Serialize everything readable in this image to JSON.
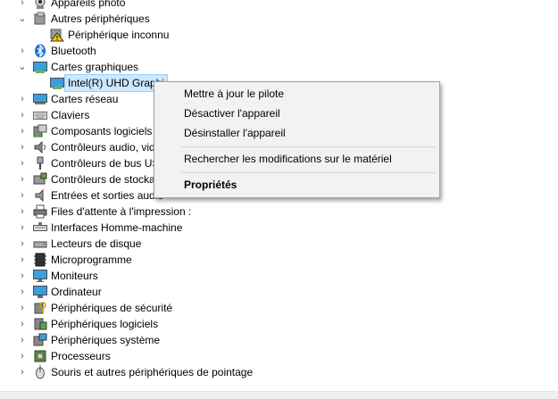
{
  "tree": {
    "items": [
      {
        "label": "Appareils photo",
        "icon": "camera-icon",
        "chevron": "›"
      },
      {
        "label": "Autres périphériques",
        "icon": "unknown-device-icon",
        "chevron": "⌄"
      },
      {
        "label": "Périphérique inconnu",
        "icon": "warning-device-icon",
        "chevron": ""
      },
      {
        "label": "Bluetooth",
        "icon": "bluetooth-icon",
        "chevron": "›"
      },
      {
        "label": "Cartes graphiques",
        "icon": "display-adapter-icon",
        "chevron": "⌄"
      },
      {
        "label": "Intel(R) UHD Graphi",
        "icon": "display-adapter-icon",
        "chevron": ""
      },
      {
        "label": "Cartes réseau",
        "icon": "network-icon",
        "chevron": "›"
      },
      {
        "label": "Claviers",
        "icon": "keyboard-icon",
        "chevron": "›"
      },
      {
        "label": "Composants logiciels",
        "icon": "software-component-icon",
        "chevron": "›"
      },
      {
        "label": "Contrôleurs audio, vid",
        "icon": "audio-icon",
        "chevron": "›"
      },
      {
        "label": "Contrôleurs de bus US",
        "icon": "usb-icon",
        "chevron": "›"
      },
      {
        "label": "Contrôleurs de stocka",
        "icon": "storage-icon",
        "chevron": "›"
      },
      {
        "label": "Entrées et sorties audio",
        "icon": "speaker-icon",
        "chevron": "›"
      },
      {
        "label": "Files d'attente à l'impression :",
        "icon": "printer-icon",
        "chevron": "›"
      },
      {
        "label": "Interfaces Homme-machine",
        "icon": "hid-icon",
        "chevron": "›"
      },
      {
        "label": "Lecteurs de disque",
        "icon": "disk-icon",
        "chevron": "›"
      },
      {
        "label": "Microprogramme",
        "icon": "firmware-icon",
        "chevron": "›"
      },
      {
        "label": "Moniteurs",
        "icon": "monitor-icon",
        "chevron": "›"
      },
      {
        "label": "Ordinateur",
        "icon": "computer-icon",
        "chevron": "›"
      },
      {
        "label": "Périphériques de sécurité",
        "icon": "security-device-icon",
        "chevron": "›"
      },
      {
        "label": "Périphériques logiciels",
        "icon": "software-device-icon",
        "chevron": "›"
      },
      {
        "label": "Périphériques système",
        "icon": "system-device-icon",
        "chevron": "›"
      },
      {
        "label": "Processeurs",
        "icon": "processor-icon",
        "chevron": "›"
      },
      {
        "label": "Souris et autres périphériques de pointage",
        "icon": "mouse-icon",
        "chevron": "›"
      }
    ]
  },
  "context_menu": {
    "update_driver": "Mettre à jour le pilote",
    "disable_device": "Désactiver l'appareil",
    "uninstall_device": "Désinstaller l'appareil",
    "scan_changes": "Rechercher les modifications sur le matériel",
    "properties": "Propriétés"
  },
  "colors": {
    "selection": "#cce8ff",
    "menu_background": "#f2f2f2"
  }
}
